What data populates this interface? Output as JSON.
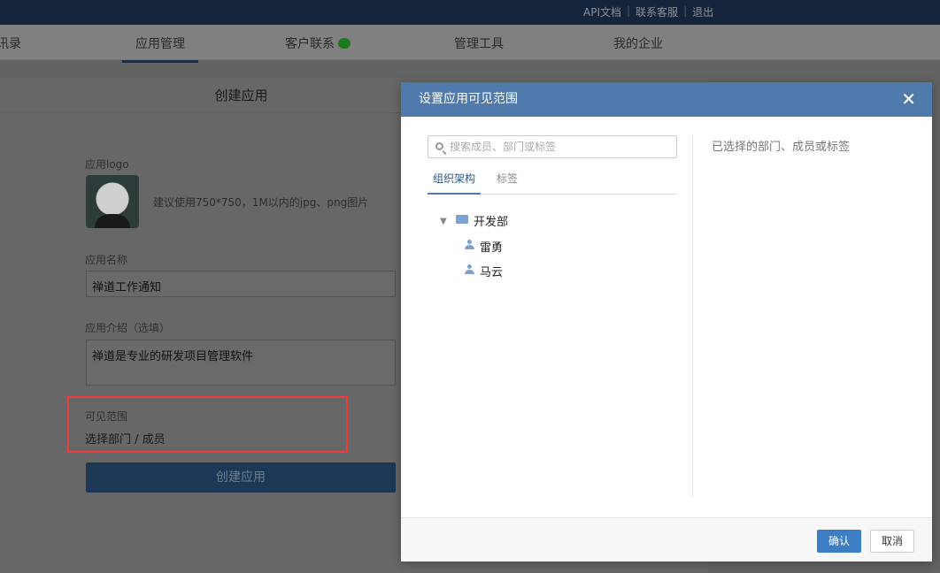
{
  "topbar": {
    "links": [
      "API文档",
      "联系客服",
      "退出"
    ]
  },
  "nav": {
    "items": [
      "讯录",
      "应用管理",
      "客户联系",
      "管理工具",
      "我的企业"
    ],
    "active": "应用管理"
  },
  "form": {
    "title": "创建应用",
    "logo_label": "应用logo",
    "logo_hint": "建议使用750*750，1M以内的jpg、png图片",
    "name_label": "应用名称",
    "name_value": "禅道工作通知",
    "intro_label": "应用介绍（选填）",
    "intro_value": "禅道是专业的研发项目管理软件",
    "scope_label": "可见范围",
    "scope_link": "选择部门 / 成员",
    "create_button": "创建应用"
  },
  "dialog": {
    "title": "设置应用可见范围",
    "search_placeholder": "搜索成员、部门或标签",
    "tabs": [
      "组织架构",
      "标签"
    ],
    "tree": {
      "department": "开发部",
      "members": [
        "雷勇",
        "马云"
      ]
    },
    "selected_title": "已选择的部门、成员或标签",
    "confirm": "确认",
    "cancel": "取消"
  },
  "colors": {
    "dialog_header": "#4f7aab",
    "confirm": "#3d7dc4",
    "highlight": "#f03c3c"
  }
}
